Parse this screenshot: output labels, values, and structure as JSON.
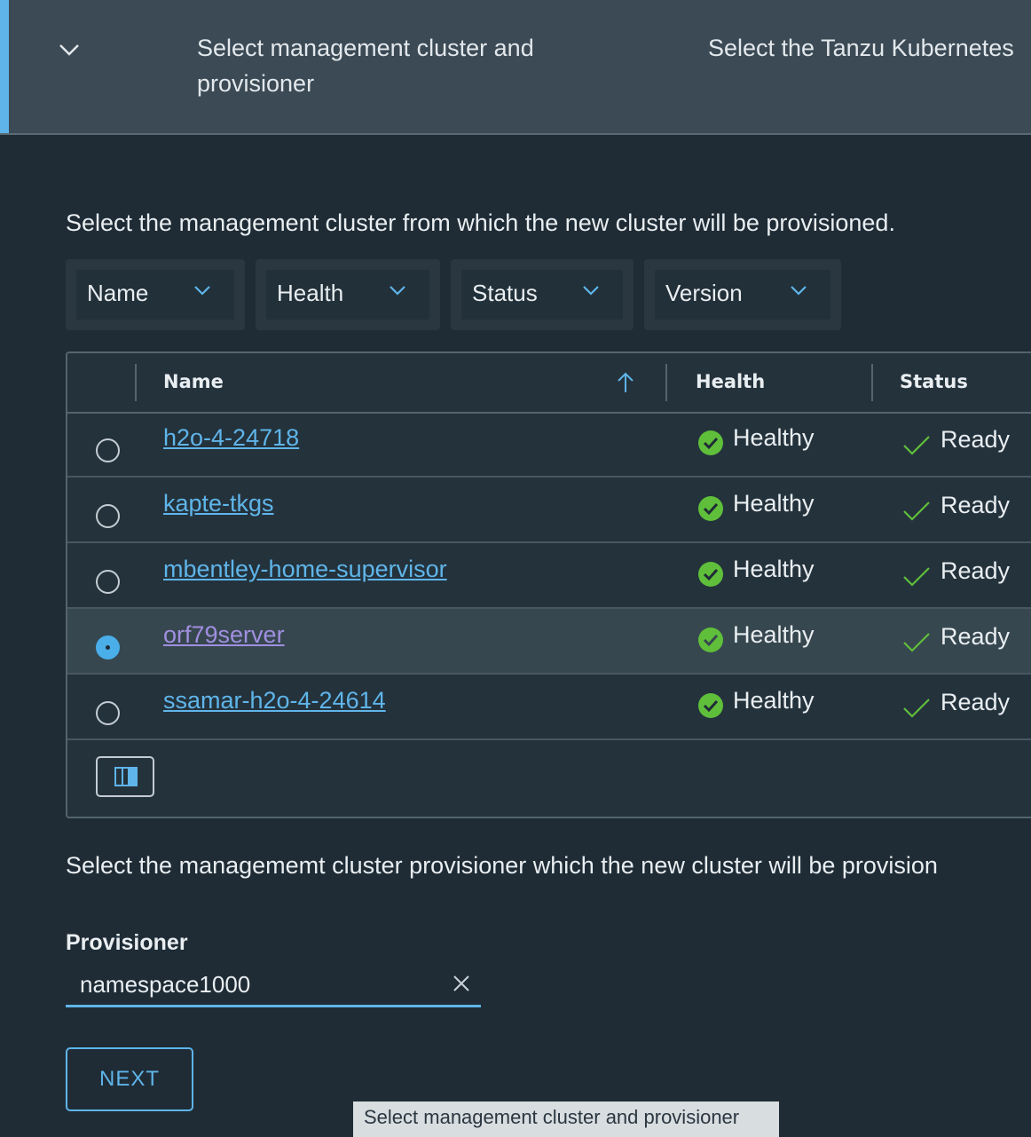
{
  "stepper": {
    "step1_label": "Select management cluster and provisioner",
    "step2_label": "Select the Tanzu Kubernetes"
  },
  "intro": "Select the management cluster from which the new cluster will be provisioned.",
  "filters": [
    {
      "label": "Name"
    },
    {
      "label": "Health"
    },
    {
      "label": "Status"
    },
    {
      "label": "Version"
    }
  ],
  "table": {
    "columns": {
      "name": "Name",
      "health": "Health",
      "status": "Status"
    },
    "rows": [
      {
        "name": "h2o-4-24718",
        "health": "Healthy",
        "status": "Ready",
        "selected": false
      },
      {
        "name": "kapte-tkgs",
        "health": "Healthy",
        "status": "Ready",
        "selected": false
      },
      {
        "name": "mbentley-home-supervisor",
        "health": "Healthy",
        "status": "Ready",
        "selected": false
      },
      {
        "name": "orf79server",
        "health": "Healthy",
        "status": "Ready",
        "selected": true
      },
      {
        "name": "ssamar-h2o-4-24614",
        "health": "Healthy",
        "status": "Ready",
        "selected": false
      }
    ]
  },
  "provisioner": {
    "intro": "Select the managememt cluster provisioner which the new cluster will be provision",
    "label": "Provisioner",
    "value": "namespace1000"
  },
  "next_label": "NEXT",
  "tooltip": "Select management cluster and provisioner",
  "colors": {
    "accent": "#5fb5e9",
    "healthy": "#5fbf3a",
    "visited": "#a08fe0"
  }
}
